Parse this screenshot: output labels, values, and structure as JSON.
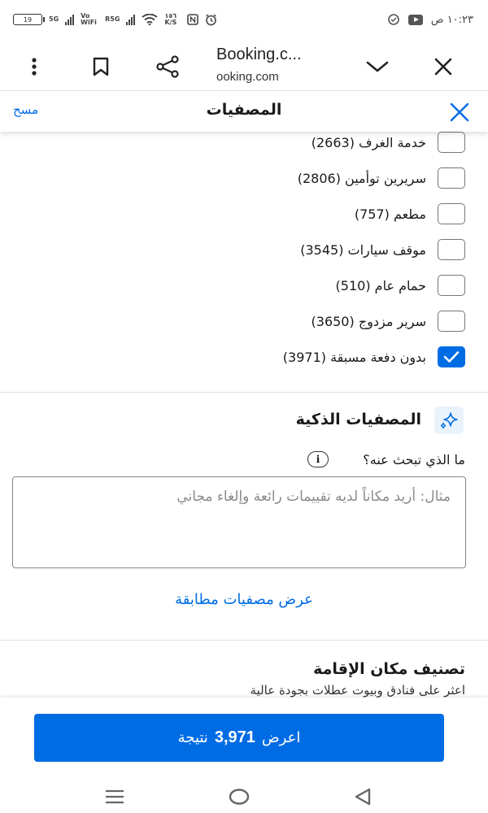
{
  "status_bar": {
    "time": "١٠:٢٣ ص",
    "battery": "19",
    "network_labels": [
      "5G",
      "Vo WiFi",
      "R5G"
    ],
    "speed": "١٥٦ K/S"
  },
  "browser": {
    "title": "Booking.c...",
    "url": "ooking.com"
  },
  "filters_header": {
    "title": "المصفيات",
    "clear_label": "مسح"
  },
  "checkbox_items": [
    {
      "label": "خدمة الغرف (2663)",
      "checked": false
    },
    {
      "label": "سريرين توأمين (2806)",
      "checked": false
    },
    {
      "label": "مطعم (757)",
      "checked": false
    },
    {
      "label": "موقف سيارات (3545)",
      "checked": false
    },
    {
      "label": "حمام عام (510)",
      "checked": false
    },
    {
      "label": "سرير مزدوج (3650)",
      "checked": false
    },
    {
      "label": "بدون دفعة مسبقة (3971)",
      "checked": true
    }
  ],
  "smart_filters": {
    "title": "المصفيات الذكية",
    "question": "ما الذي تبحث عنه؟",
    "info_symbol": "i",
    "placeholder": "مثال: أريد مكاناً لديه تقييمات رائعة وإلغاء مجاني",
    "show_link": "عرض مصفيات مطابقة"
  },
  "property_rating": {
    "title": "تصنيف مكان الإقامة",
    "subtitle": "اعثر على فنادق وبيوت عطلات بجودة عالية"
  },
  "footer": {
    "button_prefix": "اعرض",
    "result_count": "3,971",
    "button_suffix": "نتيجة"
  },
  "colors": {
    "accent": "#006ce4",
    "checkbox_border": "#767676"
  }
}
